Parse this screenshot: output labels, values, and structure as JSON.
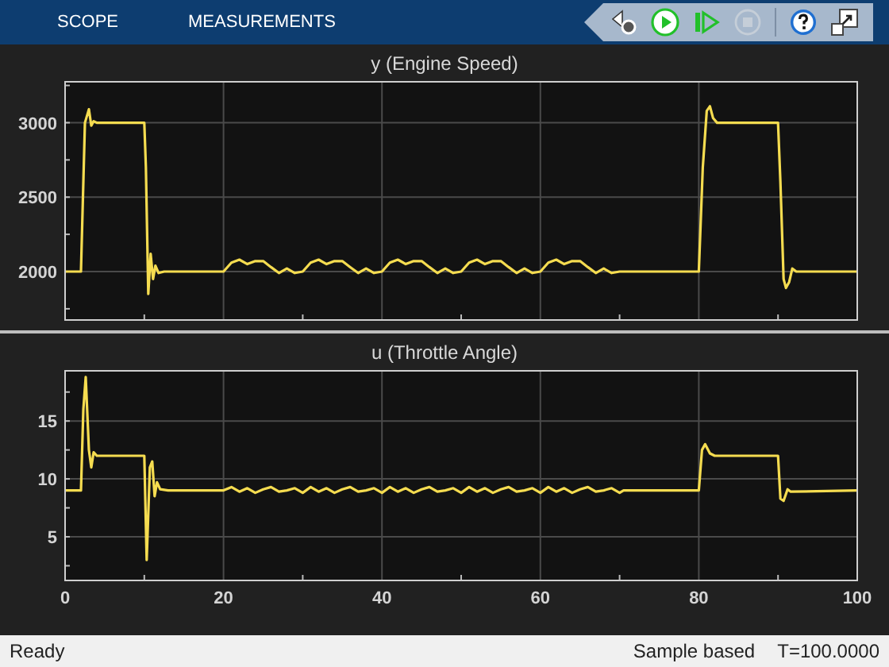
{
  "toolbar": {
    "tabs": [
      {
        "label": "SCOPE",
        "selected": false
      },
      {
        "label": "MEASUREMENTS",
        "selected": false
      }
    ],
    "controls": [
      {
        "kind": "settings",
        "disabled": false
      },
      {
        "kind": "run",
        "disabled": false
      },
      {
        "kind": "step",
        "disabled": false
      },
      {
        "kind": "stop",
        "disabled": true
      },
      {
        "kind": "help",
        "disabled": false
      },
      {
        "kind": "undock",
        "disabled": false
      }
    ]
  },
  "plots": [
    {
      "title": "y (Engine Speed)",
      "chart_data": {
        "type": "line",
        "x": [
          0,
          2,
          2.5,
          3,
          3.3,
          3.6,
          4,
          10,
          10.2,
          10.5,
          10.8,
          11.1,
          11.4,
          11.8,
          12.5,
          20,
          21,
          22,
          23,
          24,
          25,
          26,
          27,
          28,
          29,
          30,
          31,
          32,
          33,
          34,
          35,
          36,
          37,
          38,
          39,
          40,
          41,
          42,
          43,
          44,
          45,
          46,
          47,
          48,
          49,
          50,
          51,
          52,
          53,
          54,
          55,
          56,
          57,
          58,
          59,
          60,
          61,
          62,
          63,
          64,
          65,
          66,
          67,
          68,
          69,
          70,
          70.5,
          80,
          80.5,
          81,
          81.4,
          81.8,
          82.3,
          90,
          90.3,
          90.7,
          91,
          91.4,
          91.8,
          92.3,
          100
        ],
        "series": [
          {
            "color": "#f5dc50",
            "values": [
              2000,
              2000,
              3000,
              3090,
              2980,
              3010,
              3000,
              3000,
              2700,
              1850,
              2120,
              1950,
              2040,
              1990,
              2000,
              2000,
              2060,
              2080,
              2050,
              2070,
              2070,
              2030,
              1990,
              2020,
              1990,
              2000,
              2060,
              2080,
              2050,
              2070,
              2070,
              2030,
              1990,
              2020,
              1990,
              2000,
              2060,
              2080,
              2050,
              2070,
              2070,
              2030,
              1990,
              2020,
              1990,
              2000,
              2060,
              2080,
              2050,
              2070,
              2070,
              2030,
              1990,
              2020,
              1990,
              2000,
              2060,
              2080,
              2050,
              2070,
              2070,
              2030,
              1990,
              2020,
              1990,
              2000,
              2000,
              2000,
              2700,
              3080,
              3110,
              3030,
              3000,
              3000,
              2600,
              1950,
              1890,
              1930,
              2020,
              2000,
              2000
            ]
          }
        ],
        "xlim": [
          0,
          100
        ],
        "ylim": [
          1680,
          3280
        ],
        "yticks": [
          2000,
          2500,
          3000
        ],
        "grid": true
      }
    },
    {
      "title": "u (Throttle Angle)",
      "chart_data": {
        "type": "line",
        "x": [
          0,
          2,
          2.3,
          2.6,
          3,
          3.3,
          3.6,
          4,
          10,
          10.3,
          10.7,
          11,
          11.3,
          11.6,
          12,
          13,
          20,
          21,
          22,
          23,
          24,
          25,
          26,
          27,
          28,
          29,
          30,
          31,
          32,
          33,
          34,
          35,
          36,
          37,
          38,
          39,
          40,
          41,
          42,
          43,
          44,
          45,
          46,
          47,
          48,
          49,
          50,
          51,
          52,
          53,
          54,
          55,
          56,
          57,
          58,
          59,
          60,
          61,
          62,
          63,
          64,
          65,
          66,
          67,
          68,
          69,
          70,
          70.5,
          80,
          80.4,
          80.8,
          81.4,
          82,
          90,
          90.3,
          90.7,
          91.2,
          91.6,
          100
        ],
        "series": [
          {
            "color": "#f5dc50",
            "values": [
              9,
              9,
              16,
              18.8,
              12.5,
              11,
              12.3,
              12,
              12,
              3,
              11,
              11.5,
              8.5,
              9.7,
              9.1,
              9,
              9,
              9.3,
              8.9,
              9.2,
              8.8,
              9.1,
              9.3,
              8.9,
              9,
              9.2,
              8.8,
              9.3,
              8.9,
              9.2,
              8.8,
              9.1,
              9.3,
              8.9,
              9,
              9.2,
              8.8,
              9.3,
              8.9,
              9.2,
              8.8,
              9.1,
              9.3,
              8.9,
              9,
              9.2,
              8.8,
              9.3,
              8.9,
              9.2,
              8.8,
              9.1,
              9.3,
              8.9,
              9,
              9.2,
              8.8,
              9.3,
              8.9,
              9.2,
              8.8,
              9.1,
              9.3,
              8.9,
              9,
              9.2,
              8.8,
              9,
              9,
              12.5,
              13,
              12.2,
              12,
              12,
              8.3,
              8.1,
              9.1,
              8.9,
              9
            ]
          }
        ],
        "xlim": [
          0,
          100
        ],
        "ylim": [
          1.3,
          19.4
        ],
        "xticks": [
          0,
          20,
          40,
          60,
          80,
          100
        ],
        "yticks": [
          5,
          10,
          15
        ],
        "grid": true
      }
    }
  ],
  "status_bar": {
    "state": "Ready",
    "mode": "Sample based",
    "time": "T=100.0000"
  }
}
